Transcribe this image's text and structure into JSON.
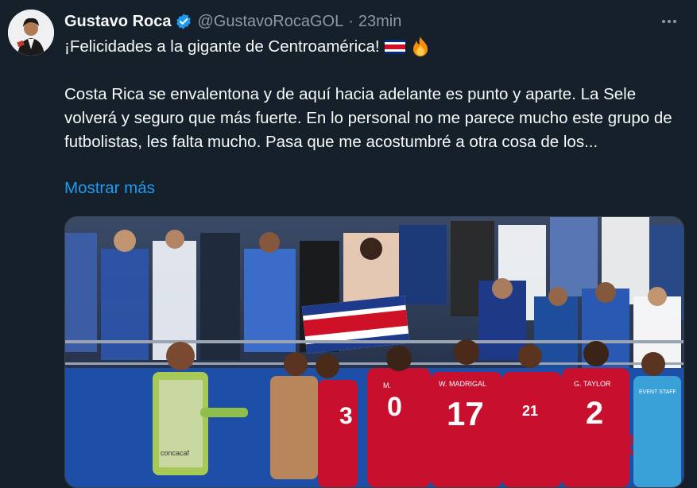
{
  "author": {
    "name": "Gustavo Roca",
    "handle": "@GustavoRocaGOL",
    "separator": "·",
    "time": "23min",
    "verified": true
  },
  "tweet": {
    "first_line": "¡Felicidades a la gigante de Centroamérica!",
    "flag_icon": "costa-rica-flag-icon",
    "fire_icon": "fire-emoji-icon",
    "body": "Costa Rica se envalentona y de aquí hacia adelante es punto y aparte. La Sele volverá y seguro que más fuerte. En lo personal no me parece mucho este grupo de futbolistas, les falta mucho. Pasa que me acostumbré a otra cosa de los...",
    "show_more": "Mostrar más"
  },
  "media": {
    "jersey_labels": [
      "W. MADRIGAL",
      "G. TAYLOR"
    ],
    "jersey_numbers": [
      "3",
      "0",
      "17",
      "21",
      "2"
    ],
    "sign_text": "EVENT STAFF",
    "keeper_text": "concacaf"
  },
  "colors": {
    "background": "#15202b",
    "link": "#1d9bf0",
    "muted": "#8b98a5",
    "verified": "#1d9bf0",
    "jersey_red": "#c8102e"
  }
}
